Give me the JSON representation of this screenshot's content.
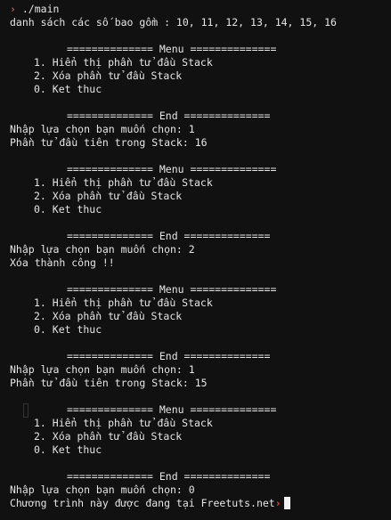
{
  "terminal": {
    "colors": {
      "background": "#111111",
      "text": "#e6e6e6",
      "prompt_arrow": "#e0533c",
      "cursor": "#f2f2f2"
    },
    "command": {
      "arrow": "›",
      "text": "./main"
    },
    "list_line": "danh sách các số bao gồm : 10, 11, 12, 13, 14, 15, 16",
    "menu_header": "============== Menu ==============",
    "menu_footer": "============== End ==============",
    "menu_items": [
      "1. Hiển thị phần tử đầu Stack",
      "2. Xóa phần tử đầu Stack",
      "0. Ket thuc"
    ],
    "rounds": [
      {
        "choice": "Nhập lựa chọn bạn muốn chọn: 1",
        "result": "Phần tử đầu tiên trong Stack: 16"
      },
      {
        "choice": "Nhập lựa chọn bạn muốn chọn: 2",
        "result": "Xóa thành công !!"
      },
      {
        "choice": "Nhập lựa chọn bạn muốn chọn: 1",
        "result": "Phần tử đầu tiên trong Stack: 15"
      }
    ],
    "final_choice": "Nhập lựa chọn bạn muốn chọn: 0",
    "final_message": "Chương trình này được đang tại Freetuts.net",
    "final_arrow": "›"
  }
}
